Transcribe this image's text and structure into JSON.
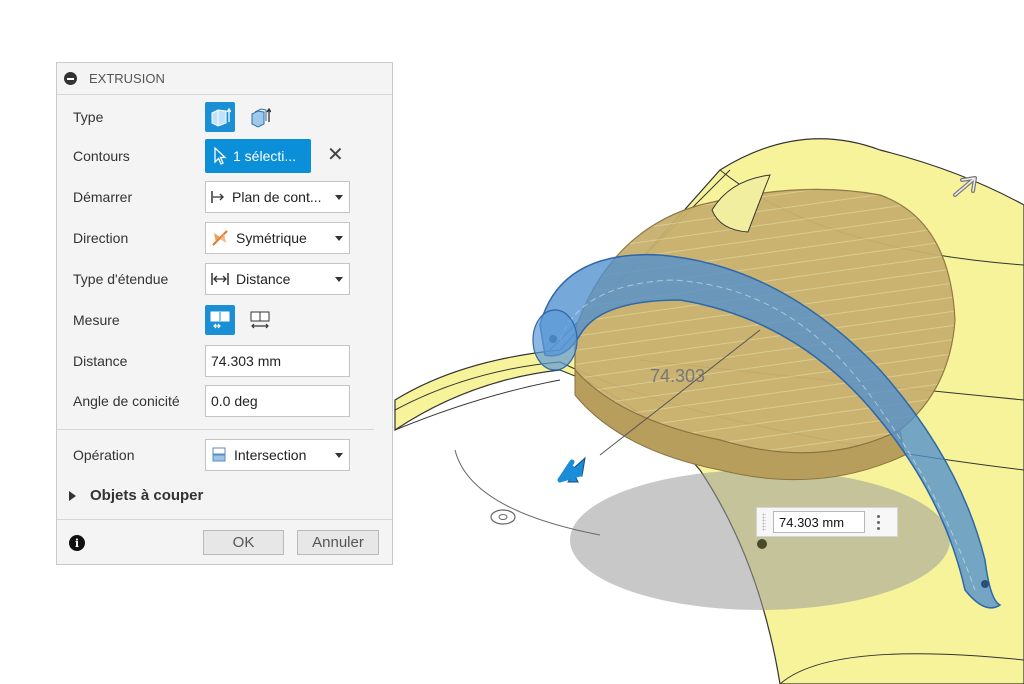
{
  "panel": {
    "title": "EXTRUSION",
    "rows": {
      "type": {
        "label": "Type"
      },
      "contours": {
        "label": "Contours",
        "selection": "1 sélecti..."
      },
      "start": {
        "label": "Démarrer",
        "value": "Plan de cont..."
      },
      "direction": {
        "label": "Direction",
        "value": "Symétrique"
      },
      "extent_type": {
        "label": "Type d'étendue",
        "value": "Distance"
      },
      "measure": {
        "label": "Mesure"
      },
      "distance": {
        "label": "Distance",
        "value": "74.303 mm"
      },
      "taper": {
        "label": "Angle de conicité",
        "value": "0.0 deg"
      },
      "operation": {
        "label": "Opération",
        "value": "Intersection"
      }
    },
    "objects_to_cut": "Objets à couper",
    "ok_label": "OK",
    "cancel_label": "Annuler",
    "info_glyph": "i"
  },
  "viewport": {
    "dimension_label": "74.303",
    "dimension_input": "74.303 mm"
  },
  "colors": {
    "accent": "#0a8fd8",
    "surface_yellow": "#f7f39a",
    "extrude_blue": "#4f8fd0",
    "wood": "#c9b070"
  }
}
